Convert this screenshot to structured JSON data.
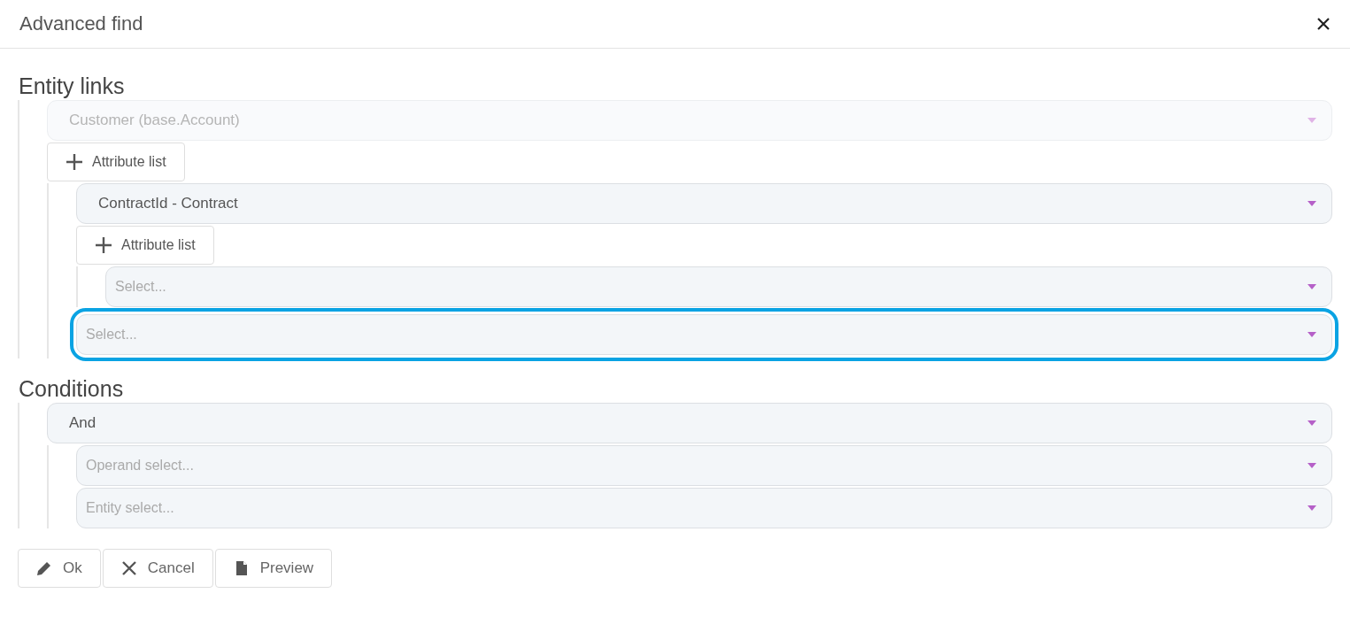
{
  "window": {
    "title": "Advanced find"
  },
  "sections": [
    {
      "title": "Entity links",
      "nodes": [
        {
          "select": {
            "value": "Customer (base.Account)",
            "disabled": true,
            "focused": false
          },
          "add_button": "Attribute list",
          "children": [
            {
              "select": {
                "value": "ContractId - Contract",
                "disabled": false,
                "focused": false
              },
              "add_button": "Attribute list",
              "children": [
                {
                  "select": {
                    "placeholder": "Select...",
                    "disabled": false,
                    "focused": false
                  }
                }
              ]
            },
            {
              "select": {
                "placeholder": "Select...",
                "disabled": false,
                "focused": true
              }
            }
          ]
        }
      ]
    },
    {
      "title": "Conditions",
      "nodes": [
        {
          "select": {
            "value": "And",
            "disabled": false,
            "focused": false
          },
          "children": [
            {
              "select": {
                "placeholder": "Operand select...",
                "disabled": false,
                "focused": false
              }
            },
            {
              "select": {
                "placeholder": "Entity select...",
                "disabled": false,
                "focused": false
              }
            }
          ]
        }
      ]
    }
  ],
  "buttons": [
    {
      "label": "Ok",
      "kind": "edit"
    },
    {
      "label": "Cancel",
      "kind": "cancel"
    },
    {
      "label": "Preview",
      "kind": "preview"
    }
  ]
}
